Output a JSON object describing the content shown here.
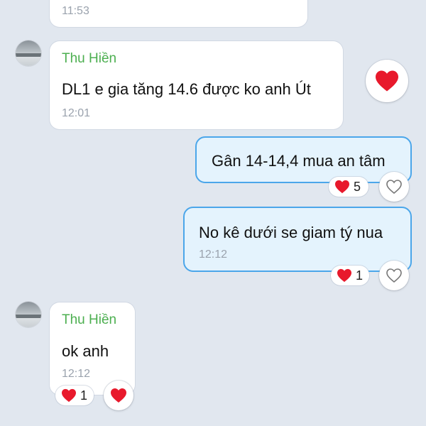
{
  "colors": {
    "background": "#e1e7ef",
    "incoming_bubble": "#ffffff",
    "outgoing_bubble": "#e4f3fd",
    "outgoing_border": "#4ba6ea",
    "sender_name": "#4caf50",
    "timestamp": "#9aa2ad",
    "heart": "#e8192c"
  },
  "messages": [
    {
      "direction": "incoming",
      "sender": "",
      "text": "",
      "time": "11:53"
    },
    {
      "direction": "incoming",
      "sender": "Thu Hiền",
      "text": "DL1 e gia tăng 14.6 được ko anh Út",
      "time": "12:01",
      "reaction_icon": "heart-icon"
    },
    {
      "direction": "outgoing",
      "text": "Gân 14-14,4 mua an tâm",
      "reaction_count": "5",
      "reaction_icon": "heart-icon",
      "action_icon": "heart-outline-icon"
    },
    {
      "direction": "outgoing",
      "text": "No kê dưới se giam tý nua",
      "time": "12:12",
      "reaction_count": "1",
      "reaction_icon": "heart-icon",
      "action_icon": "heart-outline-icon"
    },
    {
      "direction": "incoming",
      "sender": "Thu Hiền",
      "text": "ok anh",
      "time": "12:12",
      "reaction_count": "1",
      "reaction_icon": "heart-icon",
      "action_icon": "heart-icon"
    }
  ]
}
